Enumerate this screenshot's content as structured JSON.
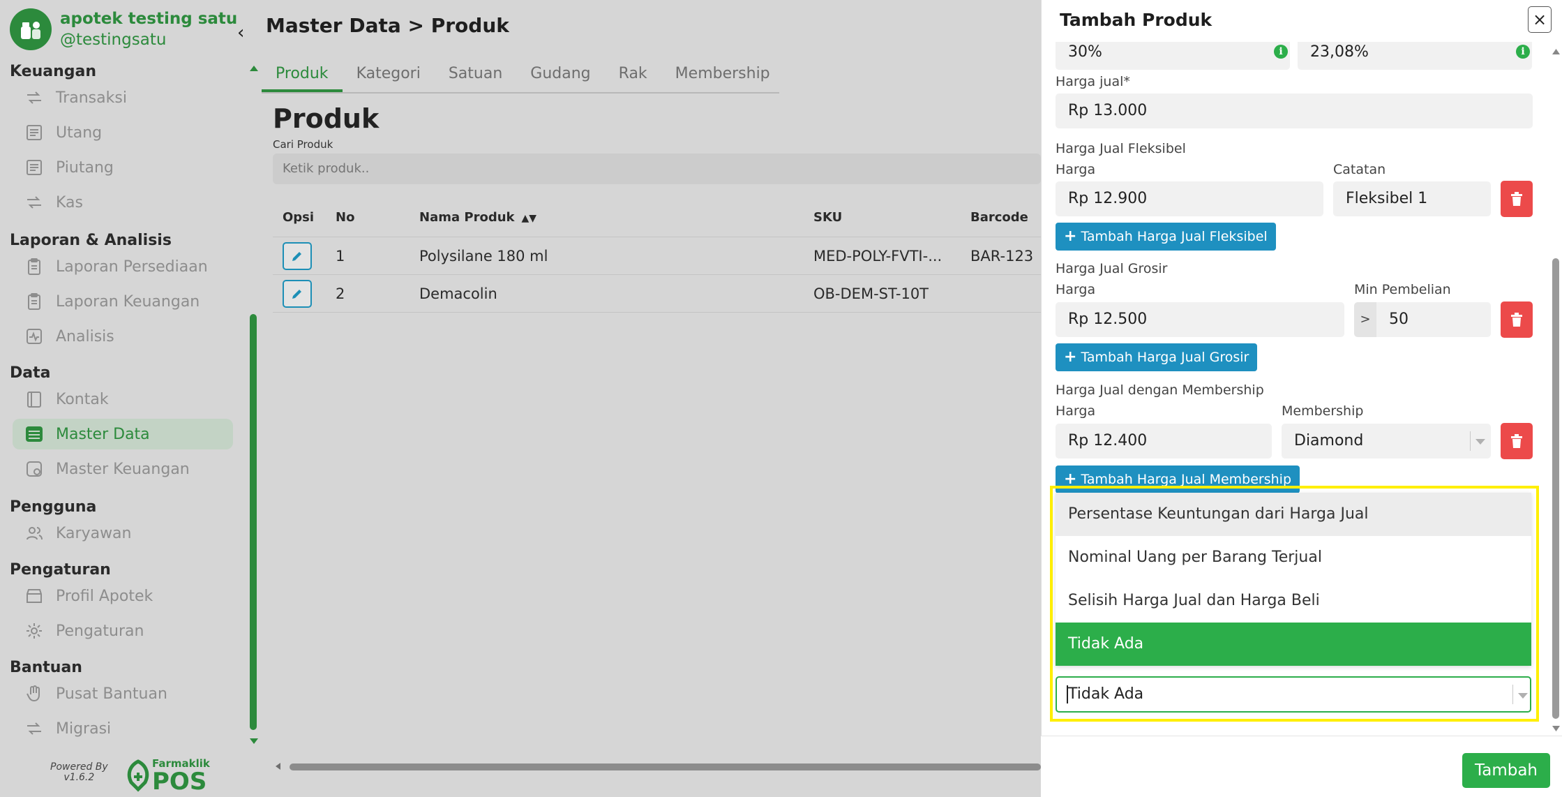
{
  "app": {
    "name": "apotek testing satu",
    "handle": "@testingsatu",
    "powered_by": "Powered By",
    "version": "v1.6.2",
    "brand_line1": "Farmaklik",
    "brand_line2": "POS"
  },
  "sidebar": {
    "sections": [
      {
        "title": "Keuangan",
        "items": [
          {
            "label": "Transaksi",
            "icon": "transaction-icon"
          },
          {
            "label": "Utang",
            "icon": "ledger-icon"
          },
          {
            "label": "Piutang",
            "icon": "ledger-icon"
          },
          {
            "label": "Kas",
            "icon": "cash-icon"
          }
        ]
      },
      {
        "title": "Laporan & Analisis",
        "items": [
          {
            "label": "Laporan Persediaan",
            "icon": "clipboard-icon"
          },
          {
            "label": "Laporan Keuangan",
            "icon": "clipboard-icon"
          },
          {
            "label": "Analisis",
            "icon": "chart-icon"
          }
        ]
      },
      {
        "title": "Data",
        "items": [
          {
            "label": "Kontak",
            "icon": "contact-book-icon"
          },
          {
            "label": "Master Data",
            "icon": "database-icon",
            "active": true
          },
          {
            "label": "Master Keuangan",
            "icon": "finance-icon"
          }
        ]
      },
      {
        "title": "Pengguna",
        "items": [
          {
            "label": "Karyawan",
            "icon": "users-icon"
          }
        ]
      },
      {
        "title": "Pengaturan",
        "items": [
          {
            "label": "Profil Apotek",
            "icon": "store-icon"
          },
          {
            "label": "Pengaturan",
            "icon": "gear-icon"
          }
        ]
      },
      {
        "title": "Bantuan",
        "items": [
          {
            "label": "Pusat Bantuan",
            "icon": "hand-icon"
          },
          {
            "label": "Migrasi",
            "icon": "migrate-icon"
          }
        ]
      }
    ]
  },
  "main": {
    "breadcrumb": "Master Data > Produk",
    "tabs": [
      "Produk",
      "Kategori",
      "Satuan",
      "Gudang",
      "Rak",
      "Membership"
    ],
    "active_tab": "Produk",
    "page_title": "Produk",
    "search": {
      "label": "Cari Produk",
      "placeholder": "Ketik produk.."
    },
    "table": {
      "headers": [
        "Opsi",
        "No",
        "Nama Produk",
        "SKU",
        "Barcode"
      ],
      "rows": [
        {
          "no": "1",
          "nama": "Polysilane 180 ml",
          "sku": "MED-POLY-FVTI-...",
          "barcode": "BAR-123"
        },
        {
          "no": "2",
          "nama": "Demacolin",
          "sku": "OB-DEM-ST-10T",
          "barcode": ""
        }
      ]
    }
  },
  "modal": {
    "title": "Tambah Produk",
    "close": "×",
    "margin_1": "30%",
    "margin_2": "23,08%",
    "harga_jual_label": "Harga jual*",
    "harga_jual_value": "Rp 13.000",
    "fleksibel": {
      "section": "Harga Jual Fleksibel",
      "harga_label": "Harga",
      "catatan_label": "Catatan",
      "harga": "Rp 12.900",
      "catatan": "Fleksibel 1",
      "add_label": "Tambah Harga Jual Fleksibel"
    },
    "grosir": {
      "section": "Harga Jual Grosir",
      "harga_label": "Harga",
      "min_label": "Min Pembelian",
      "harga": "Rp 12.500",
      "prefix": ">",
      "min": "50",
      "add_label": "Tambah Harga Jual Grosir"
    },
    "membership": {
      "section": "Harga Jual dengan Membership",
      "harga_label": "Harga",
      "membership_label": "Membership",
      "harga": "Rp 12.400",
      "membership": "Diamond",
      "add_label": "Tambah Harga Jual Membership"
    },
    "komisi_dropdown": {
      "options": [
        "Persentase Keuntungan dari Harga Jual",
        "Nominal Uang per Barang Terjual",
        "Selisih Harga Jual dan Harga Beli",
        "Tidak Ada"
      ],
      "selected": "Tidak Ada"
    },
    "submit_label": "Tambah"
  },
  "colors": {
    "accent": "#2c8a3c",
    "success": "#2cae4a",
    "info": "#1e90c0",
    "danger": "#ec4a4a",
    "highlight": "#ffef00"
  }
}
